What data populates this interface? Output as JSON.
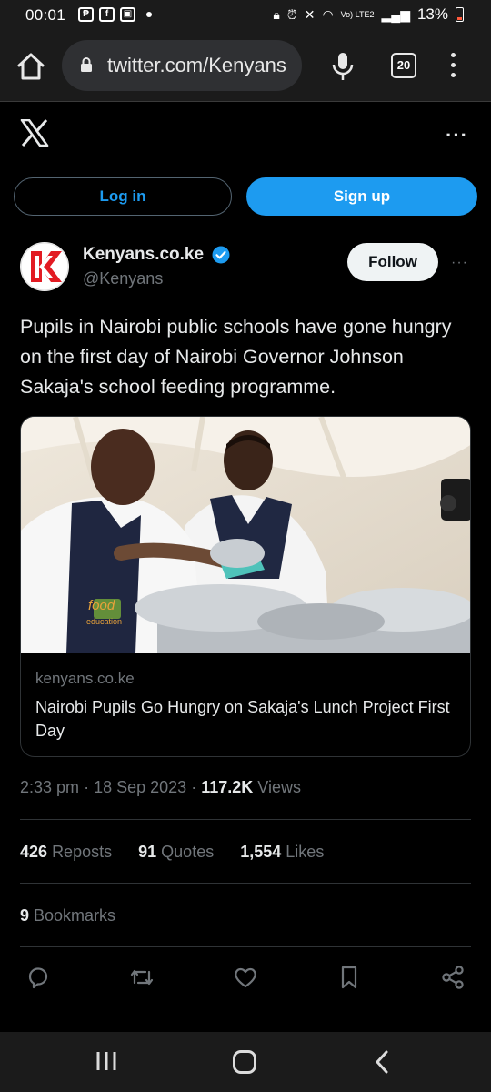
{
  "status_bar": {
    "time": "00:01",
    "app_icons": [
      "pocket-app-icon",
      "facebook-icon",
      "image-icon"
    ],
    "network_label": "Vo) LTE2",
    "battery": "13%"
  },
  "browser": {
    "url": "twitter.com/Kenyans",
    "tab_count": "20"
  },
  "header": {
    "login_label": "Log in",
    "signup_label": "Sign up"
  },
  "post": {
    "author_name": "Kenyans.co.ke",
    "handle": "@Kenyans",
    "follow_label": "Follow",
    "text": "Pupils in Nairobi public schools have gone hungry on the first day of Nairobi Governor Johnson Sakaja's school feeding programme.",
    "card": {
      "domain": "kenyans.co.ke",
      "title": "Nairobi Pupils Go Hungry on Sakaja's Lunch Project First Day",
      "apron_text": "food",
      "apron_subtext": "education"
    },
    "time": "2:33 pm",
    "date": "18 Sep 2023",
    "views_count": "117.2K",
    "views_label": "Views",
    "separator": "·",
    "reposts_count": "426",
    "reposts_label": "Reposts",
    "quotes_count": "91",
    "quotes_label": "Quotes",
    "likes_count": "1,554",
    "likes_label": "Likes",
    "bookmarks_count": "9",
    "bookmarks_label": "Bookmarks"
  },
  "colors": {
    "accent": "#1d9bf0",
    "background": "#000000",
    "muted_text": "#71767b",
    "border": "#2f3336"
  }
}
